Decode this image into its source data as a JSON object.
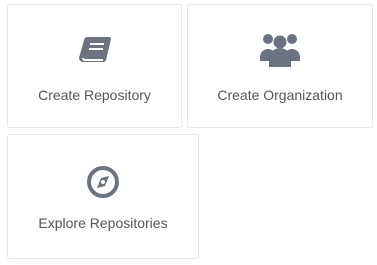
{
  "tiles": [
    {
      "label": "Create Repository",
      "icon": "book-icon"
    },
    {
      "label": "Create Organization",
      "icon": "users-icon"
    },
    {
      "label": "Explore Repositories",
      "icon": "compass-icon"
    }
  ],
  "colors": {
    "icon": "#6b7380",
    "label": "#555555",
    "border": "#e7e7e7"
  }
}
